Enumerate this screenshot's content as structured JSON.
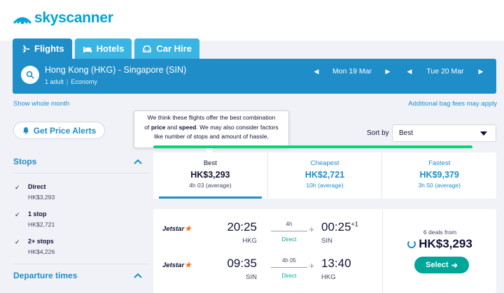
{
  "brand": {
    "name": "skyscanner",
    "color": "#00a4d8"
  },
  "tabs": [
    {
      "label": "Flights",
      "icon": "plane-icon",
      "active": true
    },
    {
      "label": "Hotels",
      "icon": "bed-icon",
      "active": false
    },
    {
      "label": "Car Hire",
      "icon": "car-icon",
      "active": false
    }
  ],
  "search": {
    "route": "Hong Kong (HKG) - Singapore (SIN)",
    "passengers": "1 adult",
    "cabin": "Economy",
    "depart_date": "Mon 19 Mar",
    "return_date": "Tue 20 Mar"
  },
  "links": {
    "show_month": "Show whole month",
    "bag_fees": "Additional bag fees may apply"
  },
  "price_alert": {
    "label": "Get Price Alerts"
  },
  "tooltip": {
    "line1": "We think these flights offer the best combination",
    "line2_pre": "of",
    "line2_b1": "price",
    "line2_and": "and",
    "line2_b2": "speed",
    "line2_post": ". We may also consider factors",
    "line3": "like number of stops and amount of hassle."
  },
  "sort": {
    "label": "Sort by",
    "value": "Best"
  },
  "summary": [
    {
      "label": "Best",
      "price": "HK$3,293",
      "time": "4h 03 (average)"
    },
    {
      "label": "Cheapest",
      "price": "HK$2,721",
      "time": "10h (average)"
    },
    {
      "label": "Fastest",
      "price": "HK$9,379",
      "time": "3h 50 (average)"
    }
  ],
  "sidebar": {
    "stops_title": "Stops",
    "stops": [
      {
        "name": "Direct",
        "price": "HK$3,293"
      },
      {
        "name": "1 stop",
        "price": "HK$2,721"
      },
      {
        "name": "2+ stops",
        "price": "HK$4,226"
      }
    ],
    "departure_title": "Departure times"
  },
  "result": {
    "deals": "6 deals from",
    "price": "HK$3,293",
    "select_label": "Select",
    "legs": [
      {
        "airline": "Jetstar",
        "dep_time": "20:25",
        "dep_code": "HKG",
        "duration": "4h",
        "stops": "Direct",
        "arr_time": "00:25",
        "arr_offset": "+1",
        "arr_code": "SIN"
      },
      {
        "airline": "Jetstar",
        "dep_time": "09:35",
        "dep_code": "SIN",
        "duration": "4h 05",
        "stops": "Direct",
        "arr_time": "13:40",
        "arr_offset": "",
        "arr_code": "HKG"
      }
    ]
  }
}
